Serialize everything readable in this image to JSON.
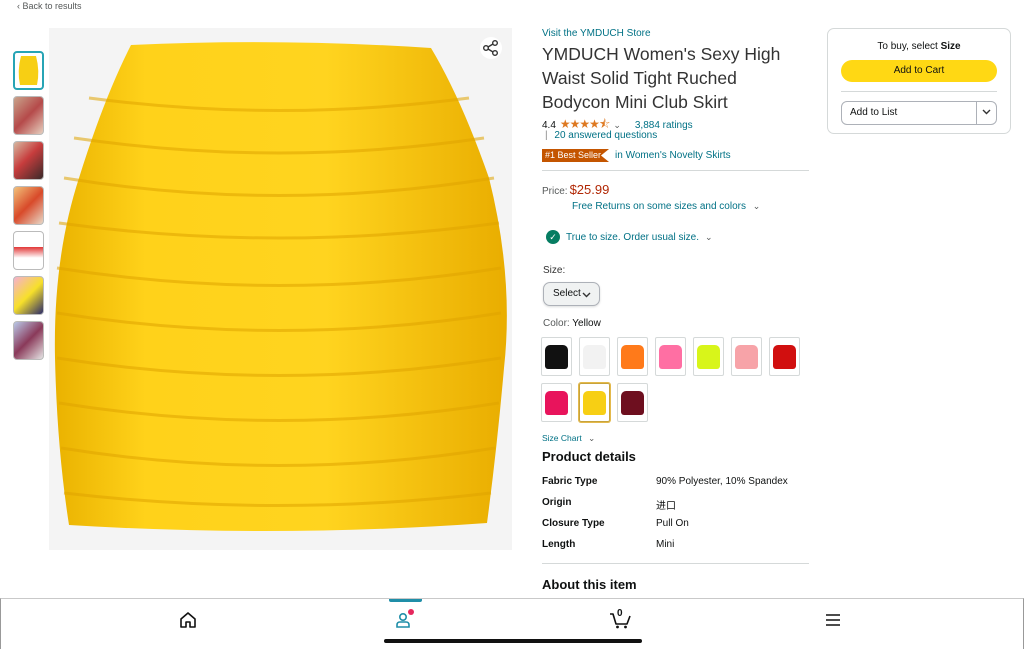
{
  "nav": {
    "back_label": "‹ Back to results"
  },
  "gallery": {
    "thumbnails": [
      {
        "name": "thumb-1"
      },
      {
        "name": "thumb-2"
      },
      {
        "name": "thumb-3"
      },
      {
        "name": "thumb-4"
      },
      {
        "name": "thumb-5"
      },
      {
        "name": "thumb-6"
      },
      {
        "name": "thumb-7"
      }
    ],
    "share_icon": "share-icon"
  },
  "product": {
    "store_link": "Visit the YMDUCH Store",
    "title": "YMDUCH Women's Sexy High Waist Solid Tight Ruched Bodycon Mini Club Skirt",
    "rating_value": "4.4",
    "stars": "★★★★⯪",
    "ratings_count": "3,884 ratings",
    "answered": "20 answered questions",
    "best_seller_badge": "#1 Best Seller",
    "best_seller_category": "in Women's Novelty Skirts",
    "price_label": "Price:",
    "price": "$25.99",
    "returns": "Free Returns on some sizes and colors",
    "fit_note": "True to size. Order usual size.",
    "size_label": "Size:",
    "size_select": "Select",
    "color_label": "Color:",
    "color_value": "Yellow",
    "size_chart": "Size Chart",
    "swatches": [
      {
        "color": "#111111"
      },
      {
        "color": "#f2f2f2"
      },
      {
        "color": "#ff7a1a"
      },
      {
        "color": "#ff6fa3"
      },
      {
        "color": "#d8f51a"
      },
      {
        "color": "#f7a3a8"
      },
      {
        "color": "#d10f0f"
      },
      {
        "color": "#e8145c"
      },
      {
        "color": "#f7cf14"
      },
      {
        "color": "#6e0f1f"
      }
    ],
    "selected_swatch_index": 8
  },
  "details": {
    "heading": "Product details",
    "rows": [
      {
        "k": "Fabric Type",
        "v": "90% Polyester, 10% Spandex"
      },
      {
        "k": "Origin",
        "v": "进口"
      },
      {
        "k": "Closure Type",
        "v": "Pull On"
      },
      {
        "k": "Length",
        "v": "Mini"
      }
    ],
    "about_heading": "About this item"
  },
  "buybox": {
    "to_buy_prefix": "To buy, select",
    "to_buy_bold": "Size",
    "add_to_cart": "Add to Cart",
    "add_to_list": "Add to List"
  },
  "bottom_nav": {
    "cart_count": "0"
  },
  "colors": {
    "accent": "#ffd814",
    "link": "#007185",
    "price": "#b12704",
    "badge": "#c45500"
  }
}
